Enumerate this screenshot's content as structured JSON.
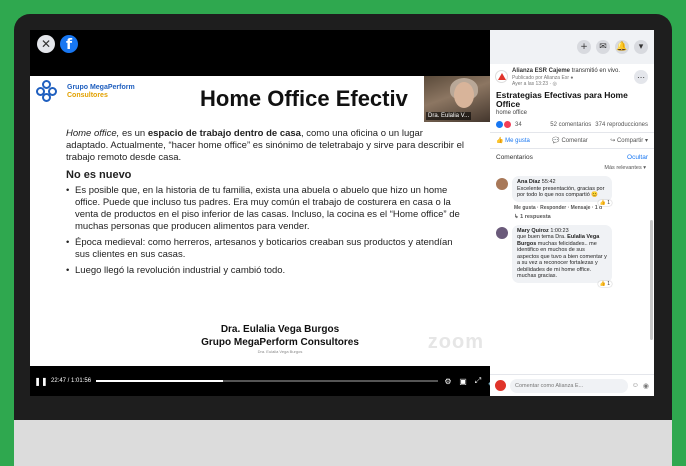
{
  "video": {
    "close_icon": "close-icon",
    "facebook_icon": "facebook-icon",
    "time_label": "22:47 / 1:01:56",
    "progress": 0.37
  },
  "slide": {
    "logo_line1": "Grupo MegaPerform",
    "logo_line2": "Consultores",
    "title": "Home Office Efectiv",
    "webcam_label": "Dra. Eulalia V...",
    "intro_italic": "Home office,",
    "intro_mid": " es un ",
    "intro_bold": "espacio de trabajo dentro de casa",
    "intro_rest": ", como una oficina o un lugar adaptado. Actualmente, “hacer home office” es sinónimo de teletrabajo y sirve para describir el trabajo remoto desde casa.",
    "section_heading": "No es nuevo",
    "bullets": [
      "Es posible que, en la historia de tu familia, exista una abuela o abuelo que hizo un home office. Puede que incluso tus padres. Era muy común el trabajo de costurera en casa o la venta de productos en el piso inferior de las casas.  Incluso, la cocina es el “Home office” de muchas personas que producen alimentos para vender.",
      "Época medieval: como herreros, artesanos y boticarios creaban sus productos y atendían sus clientes en sus casas.",
      "Luego llegó la revolución industrial y cambió todo."
    ],
    "signature_name": "Dra. Eulalia Vega Burgos",
    "signature_org": "Grupo MegaPerform Consultores",
    "signature_tiny": "Dra. Eulalia Vega Burgos",
    "watermark": "zoom"
  },
  "side": {
    "post": {
      "page_name": "Alianza ESR Cajeme",
      "action": " transmitió en vivo.",
      "published": "Publicado por Alianza Esr ●",
      "time": "Ayer a las 13:23 · ◎",
      "title": "Estrategias Efectivas para Home Office",
      "subtitle": "home office",
      "reaction_count": "34",
      "comments_count": "52 comentarios",
      "views": "374 reproducciones",
      "like_label": "Me gusta",
      "comment_label": "Comentar",
      "share_label": "Compartir"
    },
    "comments_header": "Comentarios",
    "hide_label": "Ocultar",
    "sort_label": "Más relevantes ▾",
    "comments": [
      {
        "author": "Ana Díaz",
        "timecode": "55:42",
        "text": "Excelente presentación, gracias por por todo lo que nos compartió 😊",
        "reactions": "1",
        "actions": "Me gusta · Responder · Mensaje · 1 d",
        "replies": "↳ 1 respuesta"
      },
      {
        "author": "Mary Quiroz",
        "timecode": "1:00:23",
        "text_pre": "que buen tema Dra. ",
        "text_bold": "Eulalia Vega Burgos",
        "text_post": " muchas felicidades.. me identifico en muchos de sus aspectos que tuvo a bien comentar y a su vez a reconocer fortalezas y debilidades de mi home office. muchas gracias.",
        "reactions": "1"
      }
    ],
    "composer_placeholder": "Comentar como Alianza E..."
  }
}
